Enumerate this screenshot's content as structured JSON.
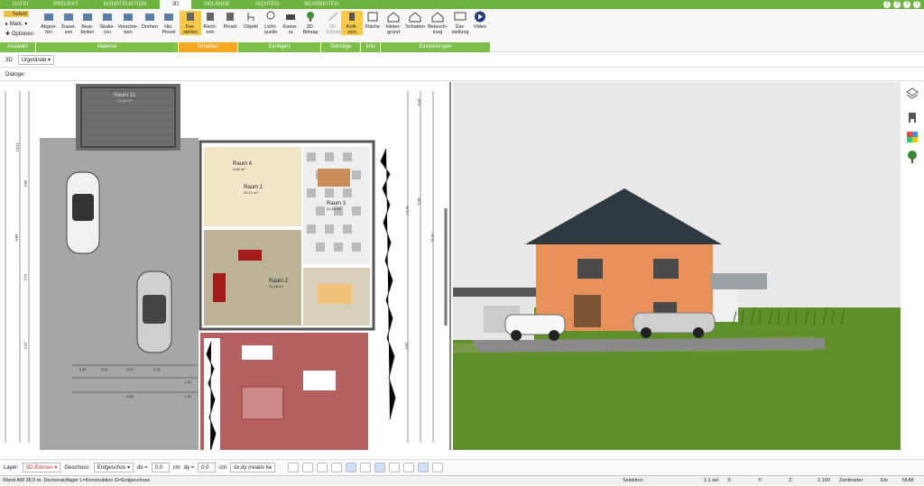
{
  "tabs": [
    "DATEI",
    "PROJEKT",
    "KONSTRUKTION",
    "3D",
    "GELÄNDE",
    "SICHTEN",
    "BEARBEITEN"
  ],
  "active_tab": "3D",
  "window_controls": [
    "?",
    "?",
    "?",
    "?"
  ],
  "ribbon": {
    "auswahl": {
      "select": "Selekt",
      "mark": "Mark.",
      "optionen": "Optionen",
      "group": "Auswahl"
    },
    "material": {
      "items": [
        "Abgrei-\nfen",
        "Zuwei-\nsen",
        "Bear-\nbeiten",
        "Skalie-\nren",
        "Verschie-\nben",
        "Drehen",
        "Hin.\nPinsel"
      ],
      "group": "Material"
    },
    "schatten": {
      "items": [
        "Dar-\nstellen",
        "Rech-\nnen",
        "Pinsel"
      ],
      "group": "Schatten"
    },
    "einfuegen": {
      "items": [
        "Objekt",
        "Licht-\nquelle",
        "Kame-\nra",
        "3D-\nBitmap"
      ],
      "group": "Einfügen"
    },
    "sonstige": {
      "items": [
        "3D-\nSchnitt",
        "Kolli-\nsion"
      ],
      "group": "Sonstige"
    },
    "info": {
      "items": [
        "Fläche"
      ],
      "group": "Info"
    },
    "einstellungen": {
      "items": [
        "Hinter-\ngrund",
        "Schatten",
        "Beleuch-\ntung",
        "Dar-\nstellung",
        "Video"
      ],
      "group": "Einstellungen"
    }
  },
  "toolbar2": {
    "view": "3D",
    "terrain": "Urgelände"
  },
  "toolbar3": {
    "label": "Dialoge:"
  },
  "plan": {
    "rooms": [
      {
        "name": "Raum 21",
        "area": "22,40 m²"
      },
      {
        "name": "Raum 4",
        "area": "3,65 m²"
      },
      {
        "name": "Raum 1",
        "area": "20,71 m²"
      },
      {
        "name": "Raum 3",
        "area": "21,53 m²"
      },
      {
        "name": "Raum 2",
        "area": "31,45 m²"
      }
    ],
    "dims_left": [
      "10,61",
      "8,86",
      "4,89",
      "3,76",
      "0,91"
    ],
    "dims_right": [
      "11,00",
      "6,98",
      "4,14",
      "10,18",
      "0,91"
    ],
    "dims_bottom": [
      "2,41",
      "2,01",
      "2,01",
      "0,91",
      "9,82",
      "1,10",
      "1,15"
    ]
  },
  "bottom": {
    "layer_label": "Layer:",
    "layer_value": "3D-Elemen",
    "geschoss_label": "Geschoss:",
    "geschoss_value": "Erdgeschos",
    "dx_label": "dx =",
    "dx_value": "0,0",
    "dx_unit": "cm",
    "dy_label": "dy =",
    "dy_value": "0,0",
    "dy_unit": "cm",
    "mode": "dx,dy (relativ ke"
  },
  "status": {
    "text": "Wand AW 36,5 m. Deckenauflager L=Konstruktion G=Erdgeschoss",
    "selektion": "Selektion",
    "sel": "1:1 sel",
    "x": "X:",
    "y": "Y:",
    "z": "Z:",
    "scale": "1:100",
    "unit": "Zentimeter",
    "ein": "Ein",
    "num": "NUM"
  },
  "colors": {
    "green": "#6db33f",
    "orange": "#f5a623",
    "highlight": "#f9c94a"
  }
}
